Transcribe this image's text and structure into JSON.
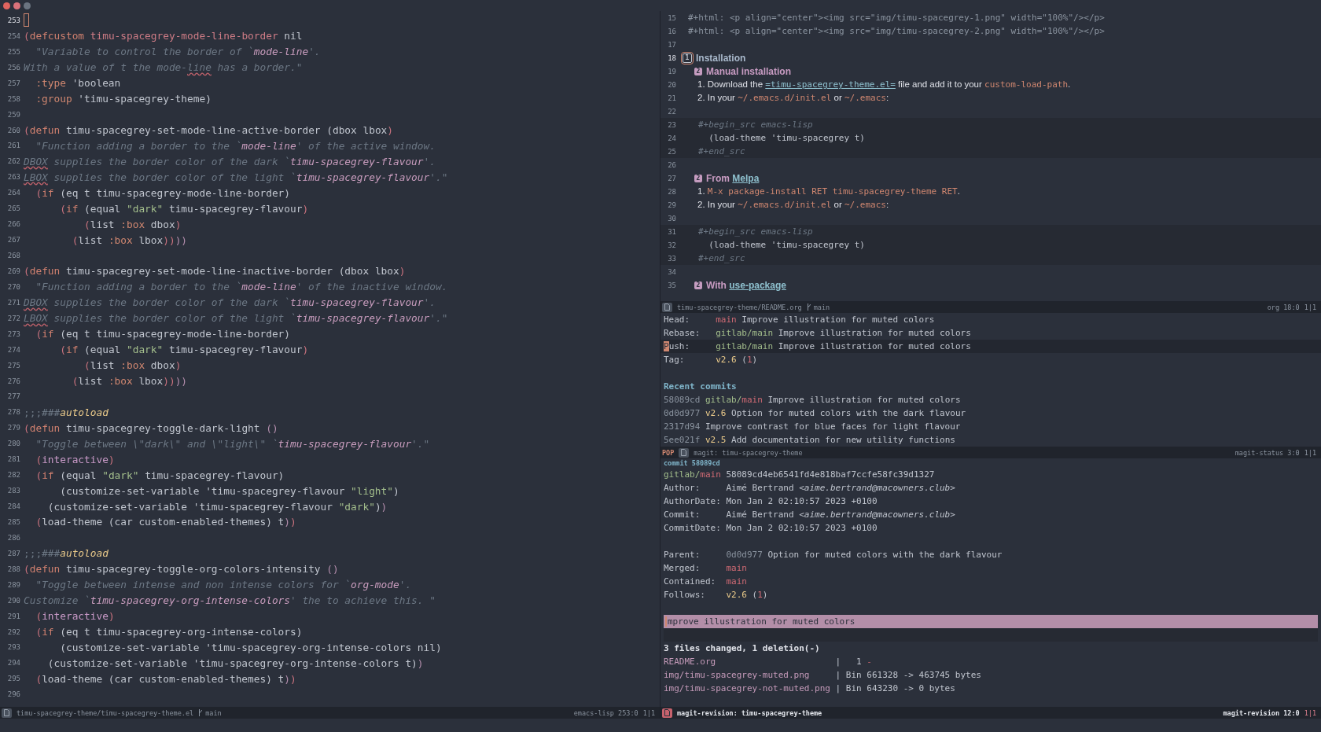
{
  "editor_left": {
    "lines": [
      {
        "number": "253",
        "cursor": true
      },
      {
        "number": "254",
        "cursor": false,
        "segments": [
          {
            "kind": "paren",
            "text": "("
          },
          {
            "kind": "keyword",
            "text": "defcustom "
          },
          {
            "kind": "variable",
            "text": "timu-spacegrey-mode-line-border"
          },
          {
            "kind": "plain",
            "text": " nil"
          }
        ]
      },
      {
        "number": "255",
        "cursor": false,
        "segments": [
          {
            "kind": "doc",
            "text": "  \"Variable to control the border of `"
          },
          {
            "kind": "docref",
            "text": "mode-line"
          },
          {
            "kind": "doc",
            "text": "'."
          }
        ]
      },
      {
        "number": "256",
        "cursor": false,
        "segments": [
          {
            "kind": "doc",
            "text": "With a value of t the mode-"
          },
          {
            "kind": "misspelled",
            "text": "line"
          },
          {
            "kind": "doc",
            "text": " has a border.\""
          }
        ]
      },
      {
        "number": "257",
        "cursor": false,
        "segments": [
          {
            "kind": "symbol",
            "text": "  :type"
          },
          {
            "kind": "plain",
            "text": " 'boolean"
          }
        ]
      },
      {
        "number": "258",
        "cursor": false,
        "segments": [
          {
            "kind": "symbol",
            "text": "  :group"
          },
          {
            "kind": "plain",
            "text": " 'timu-spacegrey-theme)"
          }
        ]
      },
      {
        "number": "259",
        "cursor": false
      },
      {
        "number": "260",
        "cursor": false,
        "segments": [
          {
            "kind": "paren",
            "text": "("
          },
          {
            "kind": "keyword",
            "text": "defun"
          },
          {
            "kind": "plain",
            "text": " timu-spacegrey-set-mode-line-active-border (dbox lbox"
          },
          {
            "kind": "paren",
            "text": ")"
          }
        ]
      },
      {
        "number": "261",
        "cursor": false,
        "segments": [
          {
            "kind": "doc",
            "text": "  \"Function adding a border to the `"
          },
          {
            "kind": "docref",
            "text": "mode-line"
          },
          {
            "kind": "doc",
            "text": "' of the active window."
          }
        ]
      },
      {
        "number": "262",
        "cursor": false,
        "segments": [
          {
            "kind": "misspelled",
            "text": "DBOX"
          },
          {
            "kind": "doc",
            "text": " supplies the border color of the dark `"
          },
          {
            "kind": "docref",
            "text": "timu-spacegrey-flavour"
          },
          {
            "kind": "doc",
            "text": "'."
          }
        ]
      },
      {
        "number": "263",
        "cursor": false,
        "segments": [
          {
            "kind": "misspelled",
            "text": "LBOX"
          },
          {
            "kind": "doc",
            "text": " supplies the border color of the light `"
          },
          {
            "kind": "docref",
            "text": "timu-spacegrey-flavour"
          },
          {
            "kind": "doc",
            "text": "'.\""
          }
        ]
      },
      {
        "number": "264",
        "cursor": false,
        "segments": [
          {
            "kind": "paren",
            "text": "  ("
          },
          {
            "kind": "keyword",
            "text": "if"
          },
          {
            "kind": "plain",
            "text": " (eq t timu-spacegrey-mode-line-border)"
          }
        ]
      },
      {
        "number": "265",
        "cursor": false,
        "segments": [
          {
            "kind": "paren",
            "text": "      ("
          },
          {
            "kind": "keyword",
            "text": "if"
          },
          {
            "kind": "plain",
            "text": " (equal "
          },
          {
            "kind": "string",
            "text": "\"dark\""
          },
          {
            "kind": "plain",
            "text": " timu-spacegrey-flavour"
          },
          {
            "kind": "paren",
            "text": ")"
          }
        ]
      },
      {
        "number": "266",
        "cursor": false,
        "segments": [
          {
            "kind": "paren",
            "text": "          ("
          },
          {
            "kind": "plain",
            "text": "list "
          },
          {
            "kind": "symbol",
            "text": ":box"
          },
          {
            "kind": "plain",
            "text": " dbox"
          },
          {
            "kind": "paren",
            "text": ")"
          }
        ]
      },
      {
        "number": "267",
        "cursor": false,
        "segments": [
          {
            "kind": "paren",
            "text": "        ("
          },
          {
            "kind": "plain",
            "text": "list "
          },
          {
            "kind": "symbol",
            "text": ":box"
          },
          {
            "kind": "plain",
            "text": " lbox"
          },
          {
            "kind": "paren",
            "text": "))"
          },
          {
            "kind": "paren2",
            "text": "))"
          }
        ]
      },
      {
        "number": "268",
        "cursor": false
      },
      {
        "number": "269",
        "cursor": false,
        "segments": [
          {
            "kind": "paren",
            "text": "("
          },
          {
            "kind": "keyword",
            "text": "defun"
          },
          {
            "kind": "plain",
            "text": " timu-spacegrey-set-mode-line-inactive-border (dbox lbox"
          },
          {
            "kind": "paren",
            "text": ")"
          }
        ]
      },
      {
        "number": "270",
        "cursor": false,
        "segments": [
          {
            "kind": "doc",
            "text": "  \"Function adding a border to the `"
          },
          {
            "kind": "docref",
            "text": "mode-line"
          },
          {
            "kind": "doc",
            "text": "' of the inactive window."
          }
        ]
      },
      {
        "number": "271",
        "cursor": false,
        "segments": [
          {
            "kind": "misspelled",
            "text": "DBOX"
          },
          {
            "kind": "doc",
            "text": " supplies the border color of the dark `"
          },
          {
            "kind": "docref",
            "text": "timu-spacegrey-flavour"
          },
          {
            "kind": "doc",
            "text": "'."
          }
        ]
      },
      {
        "number": "272",
        "cursor": false,
        "segments": [
          {
            "kind": "misspelled",
            "text": "LBOX"
          },
          {
            "kind": "doc",
            "text": " supplies the border color of the light `"
          },
          {
            "kind": "docref",
            "text": "timu-spacegrey-flavour"
          },
          {
            "kind": "doc",
            "text": "'.\""
          }
        ]
      },
      {
        "number": "273",
        "cursor": false,
        "segments": [
          {
            "kind": "paren",
            "text": "  ("
          },
          {
            "kind": "keyword",
            "text": "if"
          },
          {
            "kind": "plain",
            "text": " (eq t timu-spacegrey-mode-line-border)"
          }
        ]
      },
      {
        "number": "274",
        "cursor": false,
        "segments": [
          {
            "kind": "paren",
            "text": "      ("
          },
          {
            "kind": "keyword",
            "text": "if"
          },
          {
            "kind": "plain",
            "text": " (equal "
          },
          {
            "kind": "string",
            "text": "\"dark\""
          },
          {
            "kind": "plain",
            "text": " timu-spacegrey-flavour"
          },
          {
            "kind": "paren",
            "text": ")"
          }
        ]
      },
      {
        "number": "275",
        "cursor": false,
        "segments": [
          {
            "kind": "paren",
            "text": "          ("
          },
          {
            "kind": "plain",
            "text": "list "
          },
          {
            "kind": "symbol",
            "text": ":box"
          },
          {
            "kind": "plain",
            "text": " dbox"
          },
          {
            "kind": "paren",
            "text": ")"
          }
        ]
      },
      {
        "number": "276",
        "cursor": false,
        "segments": [
          {
            "kind": "paren",
            "text": "        ("
          },
          {
            "kind": "plain",
            "text": "list "
          },
          {
            "kind": "symbol",
            "text": ":box"
          },
          {
            "kind": "plain",
            "text": " lbox"
          },
          {
            "kind": "paren",
            "text": "))"
          },
          {
            "kind": "paren2",
            "text": "))"
          }
        ]
      },
      {
        "number": "277",
        "cursor": false
      },
      {
        "number": "278",
        "cursor": false,
        "segments": [
          {
            "kind": "comment",
            "text": ";;;###"
          },
          {
            "kind": "autoload",
            "text": "autoload"
          }
        ]
      },
      {
        "number": "279",
        "cursor": false,
        "segments": [
          {
            "kind": "paren",
            "text": "("
          },
          {
            "kind": "keyword",
            "text": "defun"
          },
          {
            "kind": "plain",
            "text": " timu-spacegrey-toggle-dark-light "
          },
          {
            "kind": "paren2",
            "text": "()"
          }
        ]
      },
      {
        "number": "280",
        "cursor": false,
        "segments": [
          {
            "kind": "doc",
            "text": "  \"Toggle between \\\"dark\\\" and \\\"light\\\" `"
          },
          {
            "kind": "docref",
            "text": "timu-spacegrey-flavour"
          },
          {
            "kind": "doc",
            "text": "'.\""
          }
        ]
      },
      {
        "number": "281",
        "cursor": false,
        "segments": [
          {
            "kind": "paren",
            "text": "  ("
          },
          {
            "kind": "builtin",
            "text": "interactive"
          },
          {
            "kind": "paren",
            "text": ")"
          }
        ]
      },
      {
        "number": "282",
        "cursor": false,
        "segments": [
          {
            "kind": "paren",
            "text": "  ("
          },
          {
            "kind": "keyword",
            "text": "if"
          },
          {
            "kind": "plain",
            "text": " (equal "
          },
          {
            "kind": "string",
            "text": "\"dark\""
          },
          {
            "kind": "plain",
            "text": " timu-spacegrey-flavour)"
          }
        ]
      },
      {
        "number": "283",
        "cursor": false,
        "segments": [
          {
            "kind": "plain",
            "text": "      (customize-set-variable 'timu-spacegrey-flavour "
          },
          {
            "kind": "string",
            "text": "\"light\""
          },
          {
            "kind": "plain",
            "text": ")"
          }
        ]
      },
      {
        "number": "284",
        "cursor": false,
        "segments": [
          {
            "kind": "plain",
            "text": "    (customize-set-variable 'timu-spacegrey-flavour "
          },
          {
            "kind": "string",
            "text": "\"dark\""
          },
          {
            "kind": "plain",
            "text": ")"
          },
          {
            "kind": "paren2",
            "text": ")"
          }
        ]
      },
      {
        "number": "285",
        "cursor": false,
        "segments": [
          {
            "kind": "paren",
            "text": "  ("
          },
          {
            "kind": "plain",
            "text": "load-theme (car custom-enabled-themes) t"
          },
          {
            "kind": "paren2",
            "text": ")"
          },
          {
            "kind": "paren",
            "text": ")"
          }
        ]
      },
      {
        "number": "286",
        "cursor": false
      },
      {
        "number": "287",
        "cursor": false,
        "segments": [
          {
            "kind": "comment",
            "text": ";;;###"
          },
          {
            "kind": "autoload",
            "text": "autoload"
          }
        ]
      },
      {
        "number": "288",
        "cursor": false,
        "segments": [
          {
            "kind": "paren",
            "text": "("
          },
          {
            "kind": "keyword",
            "text": "defun"
          },
          {
            "kind": "plain",
            "text": " timu-spacegrey-toggle-org-colors-intensity "
          },
          {
            "kind": "paren2",
            "text": "()"
          }
        ]
      },
      {
        "number": "289",
        "cursor": false,
        "segments": [
          {
            "kind": "doc",
            "text": "  \"Toggle between intense and non intense colors for `"
          },
          {
            "kind": "docref",
            "text": "org-mode"
          },
          {
            "kind": "doc",
            "text": "'."
          }
        ]
      },
      {
        "number": "290",
        "cursor": false,
        "segments": [
          {
            "kind": "doc",
            "text": "Customize `"
          },
          {
            "kind": "docref",
            "text": "timu-spacegrey-org-intense-colors"
          },
          {
            "kind": "doc",
            "text": "' the to achieve this. \""
          }
        ]
      },
      {
        "number": "291",
        "cursor": false,
        "segments": [
          {
            "kind": "paren",
            "text": "  ("
          },
          {
            "kind": "builtin",
            "text": "interactive"
          },
          {
            "kind": "paren",
            "text": ")"
          }
        ]
      },
      {
        "number": "292",
        "cursor": false,
        "segments": [
          {
            "kind": "paren",
            "text": "  ("
          },
          {
            "kind": "keyword",
            "text": "if"
          },
          {
            "kind": "plain",
            "text": " (eq t timu-spacegrey-org-intense-colors)"
          }
        ]
      },
      {
        "number": "293",
        "cursor": false,
        "segments": [
          {
            "kind": "plain",
            "text": "      (customize-set-variable 'timu-spacegrey-org-intense-colors nil)"
          }
        ]
      },
      {
        "number": "294",
        "cursor": false,
        "segments": [
          {
            "kind": "plain",
            "text": "    (customize-set-variable 'timu-spacegrey-org-intense-colors t)"
          },
          {
            "kind": "paren2",
            "text": ")"
          }
        ]
      },
      {
        "number": "295",
        "cursor": false,
        "segments": [
          {
            "kind": "paren",
            "text": "  ("
          },
          {
            "kind": "plain",
            "text": "load-theme (car custom-enabled-themes) t"
          },
          {
            "kind": "paren2",
            "text": ")"
          },
          {
            "kind": "paren",
            "text": ")"
          }
        ]
      },
      {
        "number": "296",
        "cursor": false
      }
    ],
    "mode_line": {
      "active": false,
      "buffer": "timu-spacegrey-theme/timu-spacegrey-theme.el",
      "branch": "main",
      "mode": "emacs-lisp 253:0",
      "window": "1|1"
    }
  },
  "org_window": {
    "lines": [
      {
        "number": "15",
        "kind": "plain",
        "cursor": false,
        "segments": [
          {
            "kind": "meta",
            "text": "#+html: <p align=\"center\"><img src=\"img/timu-spacegrey-1.png\" width=\"100%\"/></p>"
          }
        ]
      },
      {
        "number": "16",
        "kind": "plain",
        "cursor": false,
        "segments": [
          {
            "kind": "meta",
            "text": "#+html: <p align=\"center\"><img src=\"img/timu-spacegrey-2.png\" width=\"100%\"/></p>"
          }
        ]
      },
      {
        "number": "17",
        "kind": "plain",
        "cursor": false
      },
      {
        "number": "18",
        "kind": "heading",
        "cursor": true,
        "badge": "1",
        "segments": [
          {
            "kind": "title",
            "text": "Installation"
          }
        ]
      },
      {
        "number": "19",
        "kind": "subheading",
        "cursor": false,
        "badge": "2",
        "segments": [
          {
            "kind": "subtitle",
            "text": "Manual installation"
          }
        ]
      },
      {
        "number": "20",
        "kind": "item",
        "cursor": false,
        "segments": [
          {
            "kind": "prose",
            "text": "1. Download the "
          },
          {
            "kind": "link",
            "text": "=timu-spacegrey-theme.el="
          },
          {
            "kind": "prose",
            "text": " file and add it to your "
          },
          {
            "kind": "path",
            "text": "custom-load-path"
          },
          {
            "kind": "prose",
            "text": "."
          }
        ]
      },
      {
        "number": "21",
        "kind": "item",
        "cursor": false,
        "segments": [
          {
            "kind": "prose",
            "text": "2. In your "
          },
          {
            "kind": "path",
            "text": "~/.emacs.d/init.el"
          },
          {
            "kind": "prose",
            "text": " or "
          },
          {
            "kind": "path",
            "text": "~/.emacs"
          },
          {
            "kind": "prose",
            "text": ":"
          }
        ]
      },
      {
        "number": "22",
        "kind": "plain",
        "cursor": false
      },
      {
        "number": "23",
        "kind": "src",
        "cursor": false,
        "segments": [
          {
            "kind": "srcmeta",
            "text": "#+begin_src emacs-lisp"
          }
        ]
      },
      {
        "number": "24",
        "kind": "src",
        "cursor": false,
        "segments": [
          {
            "kind": "plain",
            "text": "  (load-theme 'timu-spacegrey t)"
          }
        ]
      },
      {
        "number": "25",
        "kind": "src",
        "cursor": false,
        "segments": [
          {
            "kind": "srcmeta",
            "text": "#+end_src"
          }
        ]
      },
      {
        "number": "26",
        "kind": "plain",
        "cursor": false
      },
      {
        "number": "27",
        "kind": "subheading",
        "cursor": false,
        "badge": "2",
        "segments": [
          {
            "kind": "subtitle",
            "text": "From "
          },
          {
            "kind": "headlink",
            "text": "Melpa"
          }
        ]
      },
      {
        "number": "28",
        "kind": "item",
        "cursor": false,
        "segments": [
          {
            "kind": "prose",
            "text": "1. "
          },
          {
            "kind": "path",
            "text": "M-x package-install RET timu-spacegrey-theme RET"
          },
          {
            "kind": "prose",
            "text": "."
          }
        ]
      },
      {
        "number": "29",
        "kind": "item",
        "cursor": false,
        "segments": [
          {
            "kind": "prose",
            "text": "2. In your "
          },
          {
            "kind": "path",
            "text": "~/.emacs.d/init.el"
          },
          {
            "kind": "prose",
            "text": " or "
          },
          {
            "kind": "path",
            "text": "~/.emacs"
          },
          {
            "kind": "prose",
            "text": ":"
          }
        ]
      },
      {
        "number": "30",
        "kind": "plain",
        "cursor": false
      },
      {
        "number": "31",
        "kind": "src",
        "cursor": false,
        "segments": [
          {
            "kind": "srcmeta",
            "text": "#+begin_src emacs-lisp"
          }
        ]
      },
      {
        "number": "32",
        "kind": "src",
        "cursor": false,
        "segments": [
          {
            "kind": "plain",
            "text": "  (load-theme 'timu-spacegrey t)"
          }
        ]
      },
      {
        "number": "33",
        "kind": "src",
        "cursor": false,
        "segments": [
          {
            "kind": "srcmeta",
            "text": "#+end_src"
          }
        ]
      },
      {
        "number": "34",
        "kind": "plain",
        "cursor": false
      },
      {
        "number": "35",
        "kind": "subheading",
        "cursor": false,
        "badge": "2",
        "segments": [
          {
            "kind": "subtitle",
            "text": "With "
          },
          {
            "kind": "headlink",
            "text": "use-package"
          }
        ]
      }
    ],
    "mode_line": {
      "active": false,
      "buffer": "timu-spacegrey-theme/README.org",
      "branch": "main",
      "mode": "org 18:0",
      "window": "1|1"
    }
  },
  "magit_status": {
    "lines": [
      {
        "kind": "plain",
        "segments": [
          {
            "kind": "plain",
            "text": "Head:     "
          },
          {
            "kind": "branch",
            "text": "main"
          },
          {
            "kind": "plain",
            "text": " Improve illustration for muted colors"
          }
        ]
      },
      {
        "kind": "plain",
        "segments": [
          {
            "kind": "plain",
            "text": "Rebase:   "
          },
          {
            "kind": "remote",
            "text": "gitlab/main"
          },
          {
            "kind": "plain",
            "text": " Improve illustration for muted colors"
          }
        ]
      },
      {
        "kind": "current",
        "segments": [
          {
            "kind": "cursor",
            "text": "P"
          },
          {
            "kind": "plain",
            "text": "ush:     "
          },
          {
            "kind": "remote",
            "text": "gitlab/main"
          },
          {
            "kind": "plain",
            "text": " Improve illustration for muted colors"
          }
        ]
      },
      {
        "kind": "plain",
        "segments": [
          {
            "kind": "plain",
            "text": "Tag:      "
          },
          {
            "kind": "tag",
            "text": "v2.6"
          },
          {
            "kind": "plain",
            "text": " ("
          },
          {
            "kind": "branch",
            "text": "1"
          },
          {
            "kind": "plain",
            "text": ")"
          }
        ]
      },
      {
        "kind": "plain"
      },
      {
        "kind": "plain",
        "segments": [
          {
            "kind": "heading",
            "text": "Recent commits"
          }
        ]
      },
      {
        "kind": "plain",
        "segments": [
          {
            "kind": "hash",
            "text": "58089cd "
          },
          {
            "kind": "remote",
            "text": "gitlab/"
          },
          {
            "kind": "branch",
            "text": "main"
          },
          {
            "kind": "plain",
            "text": " Improve illustration for muted colors"
          }
        ]
      },
      {
        "kind": "plain",
        "segments": [
          {
            "kind": "hash",
            "text": "0d0d977 "
          },
          {
            "kind": "tag",
            "text": "v2.6"
          },
          {
            "kind": "plain",
            "text": " Option for muted colors with the dark flavour"
          }
        ]
      },
      {
        "kind": "plain",
        "segments": [
          {
            "kind": "hash",
            "text": "2317d94"
          },
          {
            "kind": "plain",
            "text": " Improve contrast for blue faces for light flavour"
          }
        ]
      },
      {
        "kind": "plain",
        "segments": [
          {
            "kind": "hash",
            "text": "5ee021f "
          },
          {
            "kind": "tag",
            "text": "v2.5"
          },
          {
            "kind": "plain",
            "text": " Add documentation for new utility functions"
          }
        ]
      }
    ],
    "mode_line": {
      "active": false,
      "prefix": "POP",
      "buffer": "magit: timu-spacegrey-theme",
      "mode": "magit-status 3:0",
      "window": "1|1"
    }
  },
  "magit_revision": {
    "header": "commit 58089cd",
    "lines": [
      {
        "kind": "plain",
        "cursor": false,
        "segments": [
          {
            "kind": "remote",
            "text": "gitlab/"
          },
          {
            "kind": "branch",
            "text": "main"
          },
          {
            "kind": "plain",
            "text": " 58089cd4eb6541fd4e818baf7ccfe58fc39d1327"
          }
        ]
      },
      {
        "kind": "plain",
        "cursor": false,
        "segments": [
          {
            "kind": "plain",
            "text": "Author:     Aimé Bertrand <"
          },
          {
            "kind": "email",
            "text": "aime.bertrand@macowners.club"
          },
          {
            "kind": "plain",
            "text": ">"
          }
        ]
      },
      {
        "kind": "plain",
        "cursor": false,
        "segments": [
          {
            "kind": "plain",
            "text": "AuthorDate: Mon Jan 2 02:10:57 2023 +0100"
          }
        ]
      },
      {
        "kind": "plain",
        "cursor": false,
        "segments": [
          {
            "kind": "plain",
            "text": "Commit:     Aimé Bertrand <"
          },
          {
            "kind": "email",
            "text": "aime.bertrand@macowners.club"
          },
          {
            "kind": "plain",
            "text": ">"
          }
        ]
      },
      {
        "kind": "plain",
        "cursor": false,
        "segments": [
          {
            "kind": "plain",
            "text": "CommitDate: Mon Jan 2 02:10:57 2023 +0100"
          }
        ]
      },
      {
        "kind": "plain",
        "cursor": false
      },
      {
        "kind": "plain",
        "cursor": false,
        "segments": [
          {
            "kind": "plain",
            "text": "Parent:     "
          },
          {
            "kind": "hash",
            "text": "0d0d977"
          },
          {
            "kind": "plain",
            "text": " Option for muted colors with the dark flavour"
          }
        ]
      },
      {
        "kind": "plain",
        "cursor": false,
        "segments": [
          {
            "kind": "plain",
            "text": "Merged:     "
          },
          {
            "kind": "branch",
            "text": "main"
          }
        ]
      },
      {
        "kind": "plain",
        "cursor": false,
        "segments": [
          {
            "kind": "plain",
            "text": "Contained:  "
          },
          {
            "kind": "branch",
            "text": "main"
          }
        ]
      },
      {
        "kind": "plain",
        "cursor": false,
        "segments": [
          {
            "kind": "plain",
            "text": "Follows:    "
          },
          {
            "kind": "tag",
            "text": "v2.6"
          },
          {
            "kind": "plain",
            "text": " ("
          },
          {
            "kind": "branch",
            "text": "1"
          },
          {
            "kind": "plain",
            "text": ")"
          }
        ]
      },
      {
        "kind": "plain",
        "cursor": false
      },
      {
        "kind": "summary",
        "cursor": true,
        "segments": [
          {
            "kind": "plain",
            "text": "mprove illustration for muted colors"
          }
        ]
      },
      {
        "kind": "spacer",
        "cursor": false
      },
      {
        "kind": "plain",
        "cursor": false,
        "segments": [
          {
            "kind": "bold",
            "text": "3 files changed, 1 deletion(-)"
          }
        ]
      },
      {
        "kind": "plain",
        "cursor": false,
        "segments": [
          {
            "kind": "file",
            "text": "README.org"
          },
          {
            "kind": "plain",
            "text": "                       |   1 "
          },
          {
            "kind": "removed",
            "text": "-"
          }
        ]
      },
      {
        "kind": "plain",
        "cursor": false,
        "segments": [
          {
            "kind": "file",
            "text": "img/timu-spacegrey-muted.png"
          },
          {
            "kind": "plain",
            "text": "     | Bin 661328 -> 463745 bytes"
          }
        ]
      },
      {
        "kind": "plain",
        "cursor": false,
        "segments": [
          {
            "kind": "file",
            "text": "img/timu-spacegrey-not-muted.png"
          },
          {
            "kind": "plain",
            "text": " | Bin 643230 -> 0 bytes"
          }
        ]
      }
    ],
    "mode_line": {
      "active": true,
      "buffer": "magit-revision: timu-spacegrey-theme",
      "mode": "magit-revision 12:0",
      "window": "1|1"
    }
  }
}
